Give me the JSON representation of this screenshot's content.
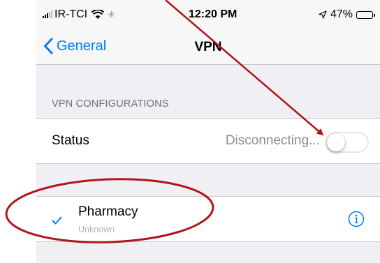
{
  "status_bar": {
    "carrier": "IR-TCI",
    "time": "12:20 PM",
    "battery": "47%",
    "icons": [
      "signal-icon",
      "wifi-icon",
      "activity-spinner-icon",
      "location-arrow-icon",
      "battery-icon"
    ]
  },
  "nav": {
    "back_label": "General",
    "title": "VPN"
  },
  "vpn_section": {
    "header": "VPN CONFIGURATIONS",
    "status_label": "Status",
    "status_value": "Disconnecting...",
    "toggle_on": false
  },
  "configs": [
    {
      "name": "Pharmacy",
      "subtitle": "Unknown",
      "selected": true
    }
  ],
  "colors": {
    "accent": "#007aff",
    "annotation": "#b0151c",
    "background": "#efeff4"
  }
}
